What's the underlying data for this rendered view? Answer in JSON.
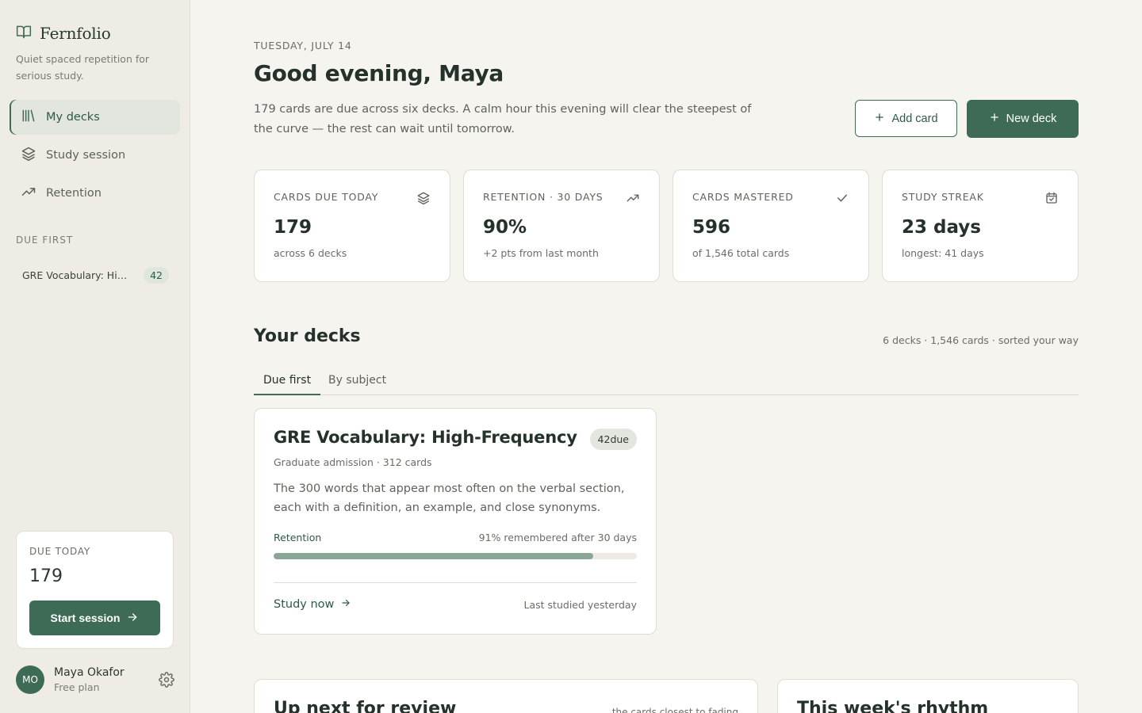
{
  "brand": {
    "name": "Fernfolio",
    "tagline": "Quiet spaced repetition for serious study."
  },
  "nav": [
    {
      "label": "My decks",
      "icon": "library-icon",
      "active": true
    },
    {
      "label": "Study session",
      "icon": "layers-icon",
      "active": false
    },
    {
      "label": "Retention",
      "icon": "trending-up-icon",
      "active": false
    }
  ],
  "sidebar_section": {
    "label": "DUE FIRST",
    "item": {
      "label": "GRE Vocabulary: High-Frequency",
      "count": "42"
    }
  },
  "due_card": {
    "label": "DUE TODAY",
    "value": "179",
    "button": "Start session"
  },
  "user": {
    "initials": "MO",
    "name": "Maya Okafor",
    "plan": "Free plan"
  },
  "header": {
    "date": "TUESDAY, JULY 14",
    "greeting": "Good evening, Maya",
    "intro": "179 cards are due across six decks. A calm hour this evening will clear the steepest of the curve — the rest can wait until tomorrow.",
    "add_label": "Add card",
    "new_label": "New deck"
  },
  "stats": [
    {
      "label": "CARDS DUE TODAY",
      "value": "179",
      "sub": "across 6 decks",
      "icon": "layers-icon"
    },
    {
      "label": "RETENTION · 30 DAYS",
      "value": "90%",
      "sub": "+2 pts from last month",
      "icon": "trending-up-icon"
    },
    {
      "label": "CARDS MASTERED",
      "value": "596",
      "sub": "of 1,546 total cards",
      "icon": "check-icon"
    },
    {
      "label": "STUDY STREAK",
      "value": "23 days",
      "sub": "longest: 41 days",
      "icon": "calendar-check-icon"
    }
  ],
  "decks": {
    "title": "Your decks",
    "meta": "6 decks · 1,546 cards · sorted your way",
    "tabs": [
      {
        "label": "Due first",
        "active": true
      },
      {
        "label": "By subject",
        "active": false
      }
    ],
    "card": {
      "title": "GRE Vocabulary: High-Frequency",
      "badge": "42due",
      "sub": "Graduate admission · 312 cards",
      "desc": "The 300 words that appear most often on the verbal section, each with a definition, an example, and close synonyms.",
      "retention_label": "Retention",
      "retention_text": "91% remembered after 30 days",
      "retention_fraction": 0.88,
      "study_label": "Study now",
      "last_studied": "Last studied yesterday"
    }
  },
  "panels": {
    "review": {
      "title": "Up next for review",
      "meta": "the cards closest to fading"
    },
    "rhythm": {
      "title": "This week's rhythm"
    }
  },
  "colors": {
    "accent": "#3d6b56",
    "background": "#f6f4ef",
    "sidebar": "#efece5",
    "progress": "#8aa694"
  }
}
